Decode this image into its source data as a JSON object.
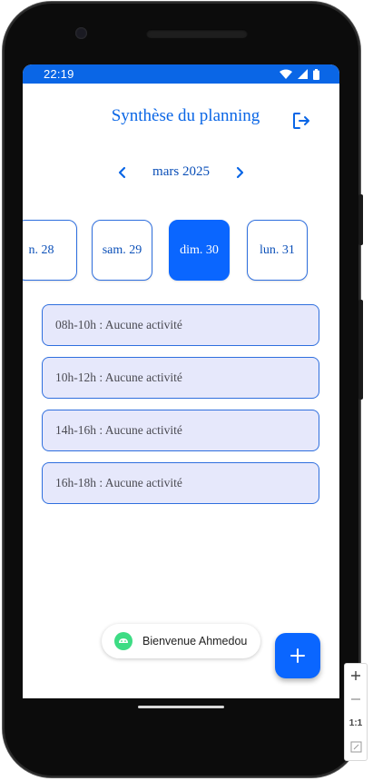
{
  "status_bar": {
    "time": "22:19"
  },
  "header": {
    "title": "Synthèse du planning"
  },
  "month_nav": {
    "label": "mars 2025"
  },
  "days": [
    {
      "label": "n. 28",
      "selected": false
    },
    {
      "label": "sam. 29",
      "selected": false
    },
    {
      "label": "dim. 30",
      "selected": true
    },
    {
      "label": "lun. 31",
      "selected": false
    }
  ],
  "slots": [
    {
      "label": "08h-10h : Aucune activité"
    },
    {
      "label": "10h-12h : Aucune activité"
    },
    {
      "label": "14h-16h : Aucune activité"
    },
    {
      "label": "16h-18h : Aucune activité"
    }
  ],
  "toast": {
    "text": "Bienvenue Ahmedou"
  },
  "zoom": {
    "reset_label": "1:1"
  },
  "colors": {
    "primary": "#0a66ff",
    "status_bar": "#0a66e6",
    "slot_bg": "#e6e8fb",
    "android_green": "#3ddc84"
  }
}
